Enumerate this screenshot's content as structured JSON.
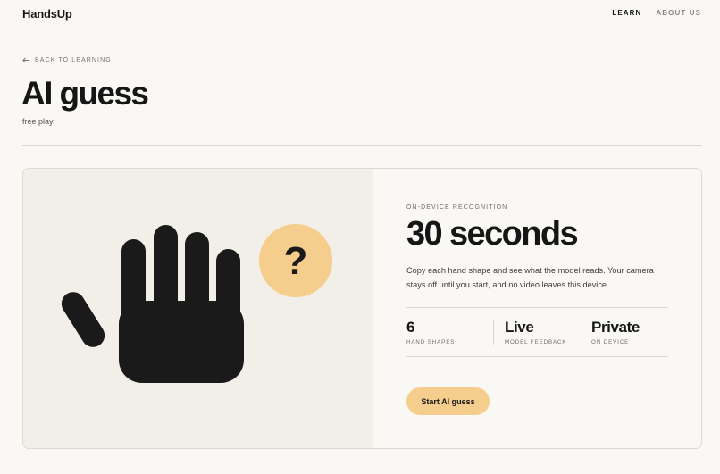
{
  "header": {
    "brand": "HandsUp",
    "nav": [
      {
        "label": "LEARN",
        "active": true
      },
      {
        "label": "ABOUT US",
        "active": false
      }
    ]
  },
  "back_link": {
    "label": "BACK TO LEARNING",
    "icon": "arrow-left-icon"
  },
  "page": {
    "title": "AI guess",
    "subtitle": "free play"
  },
  "card": {
    "illustration": {
      "icon": "raised-hand-icon",
      "badge_text": "?",
      "colors": {
        "hand": "#1a1a1a",
        "badge": "#f5cd8c",
        "panel": "#f2efe8"
      }
    },
    "kicker": "ON-DEVICE RECOGNITION",
    "headline": "30 seconds",
    "description": "Copy each hand shape and see what the model reads. Your camera stays off until you start, and no video leaves this device.",
    "stats": [
      {
        "value": "6",
        "label": "HAND SHAPES"
      },
      {
        "value": "Live",
        "label": "MODEL FEEDBACK"
      },
      {
        "value": "Private",
        "label": "ON DEVICE"
      }
    ],
    "cta_label": "Start AI guess",
    "accent_color": "#f5cd8c"
  }
}
